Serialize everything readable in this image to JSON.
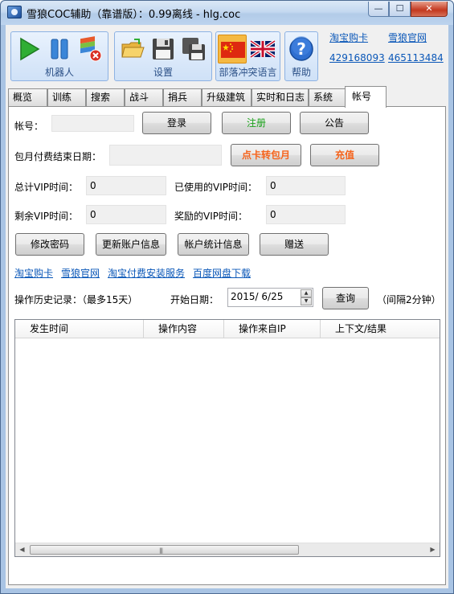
{
  "window": {
    "title": "雪狼COC辅助（靠谱版）：0.99离线 - hlg.coc",
    "min_glyph": "—",
    "max_glyph": "☐",
    "close_glyph": "✕"
  },
  "toolbar": {
    "groups": [
      {
        "label": "机器人",
        "icons": [
          "play-icon",
          "pause-icon",
          "bluestacks-close-icon"
        ]
      },
      {
        "label": "设置",
        "icons": [
          "open-folder-icon",
          "save-icon",
          "save-as-icon"
        ]
      },
      {
        "label": "部落冲突语言",
        "icons": [
          "china-flag-icon",
          "uk-flag-icon"
        ]
      },
      {
        "label": "帮助",
        "icons": [
          "help-icon"
        ]
      }
    ],
    "help_glyph": "?"
  },
  "top_links": {
    "taobao": "淘宝购卡",
    "official": "雪狼官网",
    "qq1": "429168093",
    "qq2": "465113484"
  },
  "tabs": [
    "概览",
    "训练",
    "搜索",
    "战斗",
    "捐兵",
    "升级建筑",
    "实时和日志",
    "系统",
    "帐号"
  ],
  "active_tab": "帐号",
  "account": {
    "account_label": "帐号：",
    "account_value": "",
    "login_button": "登录",
    "register_button": "注册",
    "notice_button": "公告",
    "monthly_end_label": "包月付费结束日期：",
    "monthly_end_value": "",
    "card_to_monthly_button": "点卡转包月",
    "recharge_button": "充值",
    "total_vip_label": "总计VIP时间：",
    "total_vip_value": "0",
    "used_vip_label": "已使用的VIP时间：",
    "used_vip_value": "0",
    "remaining_vip_label": "剩余VIP时间：",
    "remaining_vip_value": "0",
    "reward_vip_label": "奖励的VIP时间：",
    "reward_vip_value": "0",
    "change_password_button": "修改密码",
    "refresh_account_button": "更新账户信息",
    "account_stats_button": "帐户统计信息",
    "gift_button": "赠送",
    "links": [
      "淘宝购卡",
      "雪狼官网",
      "淘宝付费安装服务",
      "百度网盘下载"
    ],
    "history_label": "操作历史记录：（最多15天）",
    "start_date_label": "开始日期：",
    "start_date_value": "2015/  6/25",
    "query_button": "查询",
    "interval_note": "（间隔2分钟）",
    "columns": [
      "发生时间",
      "操作内容",
      "操作来自IP",
      "上下文/结果"
    ],
    "rows": []
  },
  "colors": {
    "link": "#0a57b8",
    "register_text": "#1aa11a",
    "orange_text": "#f5641d",
    "toolbar_label": "#2a4f86"
  }
}
